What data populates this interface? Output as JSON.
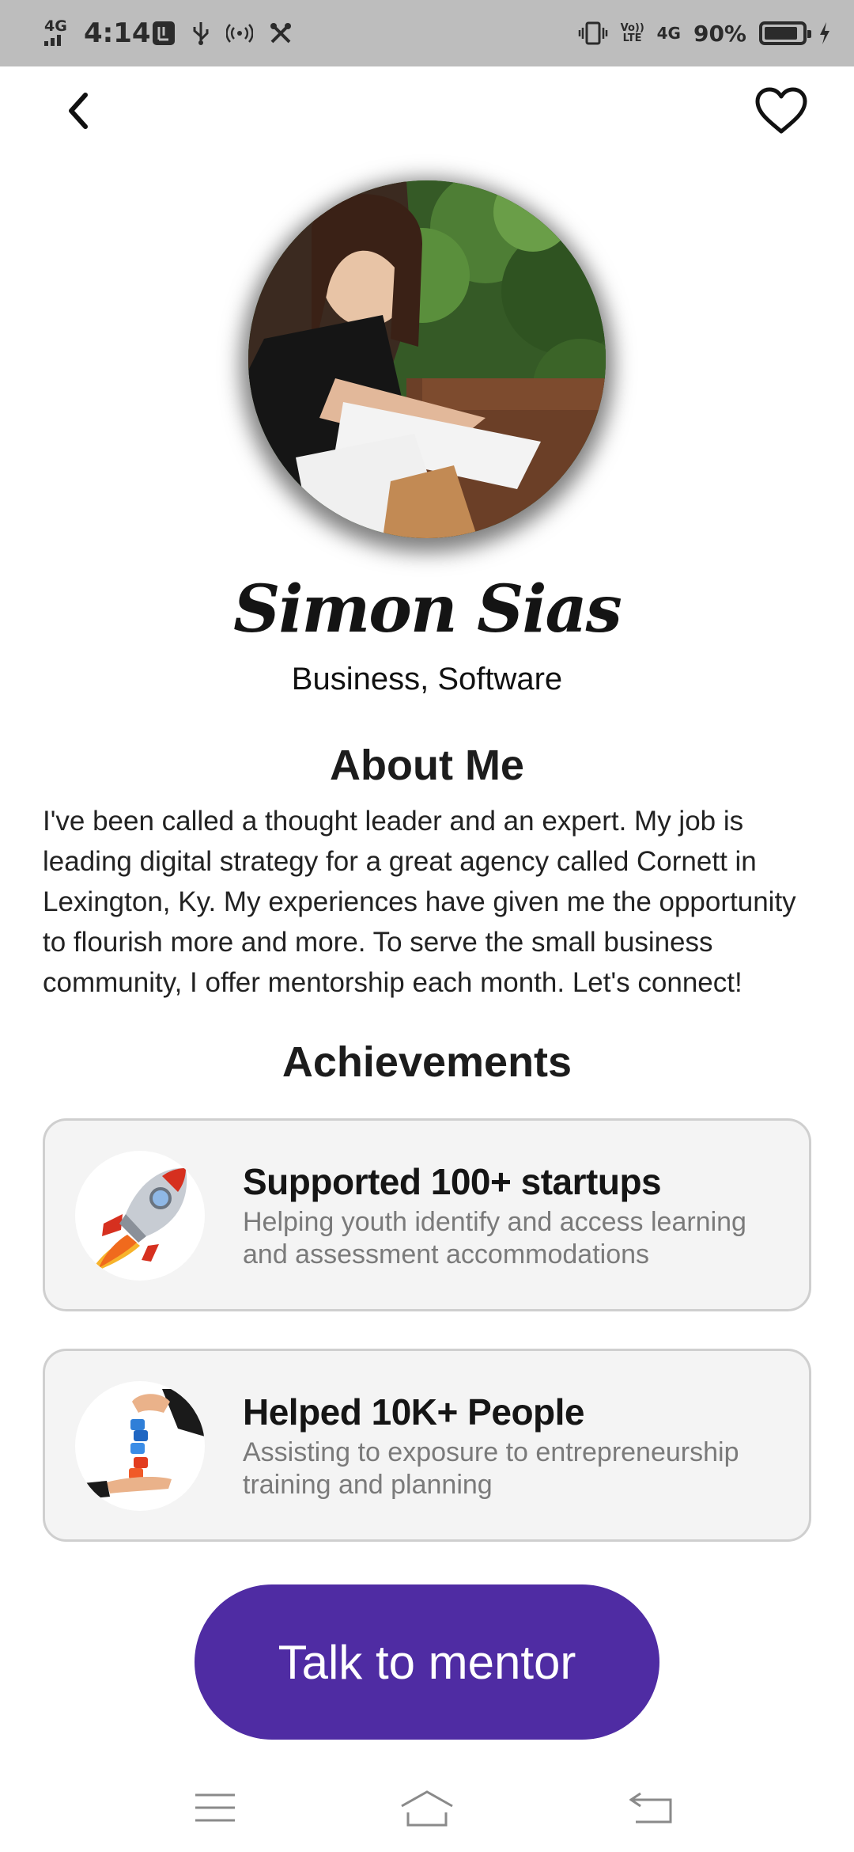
{
  "status_bar": {
    "network": "4G",
    "time": "4:14",
    "volte": "Vo)) LTE",
    "network_right": "4G",
    "battery_percent": "90%",
    "battery_level": 0.9,
    "icons": [
      "signal-icon",
      "usb-debug-icon",
      "usb-icon",
      "hotspot-icon",
      "tools-icon",
      "vibrate-icon",
      "volte-icon",
      "data-icon",
      "battery-icon",
      "charging-icon"
    ]
  },
  "header": {
    "back_icon": "chevron-left-icon",
    "favorite_icon": "heart-outline-icon"
  },
  "profile": {
    "name": "Simon Sias",
    "subtitle": "Business, Software"
  },
  "about": {
    "title": "About Me",
    "text": "I've been called a thought leader and an expert. My job is leading digital strategy for a great agency called Cornett in Lexington, Ky. My experiences have given me the opportunity to flourish more and more. To serve the small business community, I offer mentorship each month. Let's connect!"
  },
  "achievements": {
    "title": "Achievements",
    "items": [
      {
        "icon": "rocket-icon",
        "heading": "Supported 100+ startups",
        "description": "Helping youth identify and access learning and assessment accommodations"
      },
      {
        "icon": "puzzle-hands-icon",
        "heading": "Helped 10K+ People",
        "description": "Assisting to exposure to entrepreneurship training and planning"
      }
    ]
  },
  "cta": {
    "label": "Talk to mentor",
    "color": "#4f2ca3"
  },
  "nav_bar": {
    "icons": [
      "menu-icon",
      "home-icon",
      "back-icon"
    ]
  }
}
